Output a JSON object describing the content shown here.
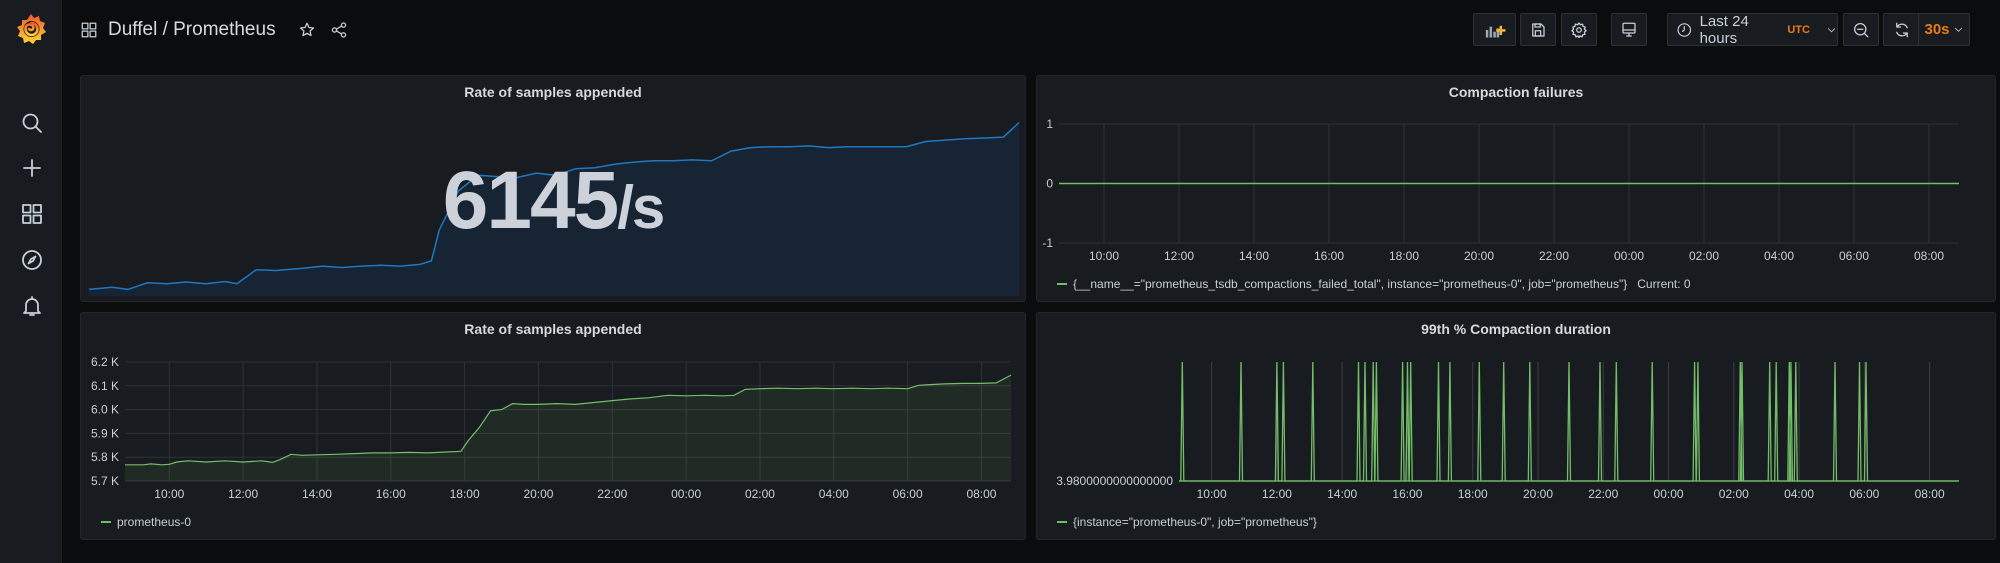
{
  "app": {
    "breadcrumb": "Duffel / Prometheus",
    "brand_color": "#f46800",
    "accent_color": "#eb7b18"
  },
  "sidebar": {
    "items": [
      {
        "id": "search",
        "icon": "search-icon",
        "label": "Search"
      },
      {
        "id": "create",
        "icon": "plus-icon",
        "label": "Create"
      },
      {
        "id": "dashboards",
        "icon": "dashboards-grid-icon",
        "label": "Dashboards"
      },
      {
        "id": "explore",
        "icon": "compass-icon",
        "label": "Explore"
      },
      {
        "id": "alerting",
        "icon": "bell-icon",
        "label": "Alerting"
      }
    ]
  },
  "toolbar": {
    "add_panel_icon": "add-panel-icon",
    "save_icon": "save-icon",
    "settings_icon": "gear-icon",
    "tv_mode_icon": "monitor-icon",
    "time_picker": {
      "label": "Last 24 hours",
      "timezone": "UTC"
    },
    "zoom_out_icon": "zoom-out-icon",
    "refresh_icon": "refresh-icon",
    "refresh_interval": "30s"
  },
  "panels": {
    "stat": {
      "title": "Rate of samples appended",
      "value": "6145",
      "unit": "/s",
      "color": "#1f78c1"
    },
    "failures": {
      "title": "Compaction failures",
      "legend": "{__name__=\"prometheus_tsdb_compactions_failed_total\", instance=\"prometheus-0\", job=\"prometheus\"}",
      "legend_current_label": "Current: 0"
    },
    "rate": {
      "title": "Rate of samples appended",
      "legend": "prometheus-0"
    },
    "duration": {
      "title": "99th % Compaction duration",
      "legend": "{instance=\"prometheus-0\", job=\"prometheus\"}"
    }
  },
  "chart_data": [
    {
      "id": "stat",
      "type": "area",
      "title": "Rate of samples appended",
      "value_label": "6145/s",
      "x_range_hours": [
        9.0,
        32.9
      ],
      "ylim": [
        5750,
        6160
      ],
      "series": [
        {
          "name": "prometheus-0",
          "color": "#1f78c1",
          "points": [
            [
              9.0,
              5765
            ],
            [
              9.6,
              5770
            ],
            [
              10.0,
              5765
            ],
            [
              10.5,
              5780
            ],
            [
              11.0,
              5778
            ],
            [
              11.5,
              5782
            ],
            [
              12.0,
              5778
            ],
            [
              12.5,
              5783
            ],
            [
              12.8,
              5778
            ],
            [
              13.3,
              5810
            ],
            [
              13.8,
              5808
            ],
            [
              14.5,
              5813
            ],
            [
              15.0,
              5818
            ],
            [
              15.5,
              5815
            ],
            [
              16.0,
              5818
            ],
            [
              16.5,
              5820
            ],
            [
              17.0,
              5818
            ],
            [
              17.5,
              5822
            ],
            [
              17.8,
              5830
            ],
            [
              18.0,
              5900
            ],
            [
              18.5,
              5990
            ],
            [
              19.0,
              6025
            ],
            [
              19.5,
              6022
            ],
            [
              20.0,
              6020
            ],
            [
              20.5,
              6030
            ],
            [
              21.0,
              6025
            ],
            [
              21.5,
              6040
            ],
            [
              22.0,
              6042
            ],
            [
              22.5,
              6050
            ],
            [
              23.0,
              6055
            ],
            [
              23.5,
              6058
            ],
            [
              24.0,
              6058
            ],
            [
              24.5,
              6060
            ],
            [
              25.0,
              6058
            ],
            [
              25.5,
              6080
            ],
            [
              26.0,
              6088
            ],
            [
              26.5,
              6090
            ],
            [
              27.0,
              6090
            ],
            [
              27.5,
              6092
            ],
            [
              28.0,
              6088
            ],
            [
              28.5,
              6090
            ],
            [
              29.0,
              6090
            ],
            [
              29.5,
              6090
            ],
            [
              30.0,
              6090
            ],
            [
              30.5,
              6102
            ],
            [
              31.0,
              6105
            ],
            [
              31.5,
              6108
            ],
            [
              32.0,
              6110
            ],
            [
              32.5,
              6112
            ],
            [
              32.9,
              6145
            ]
          ]
        }
      ]
    },
    {
      "id": "failures",
      "type": "line",
      "title": "Compaction failures",
      "x_ticks": [
        "10:00",
        "12:00",
        "14:00",
        "16:00",
        "18:00",
        "20:00",
        "22:00",
        "00:00",
        "02:00",
        "04:00",
        "06:00",
        "08:00"
      ],
      "y_ticks": [
        "1",
        "0",
        "-1"
      ],
      "ylim": [
        -1,
        1
      ],
      "x_range_hours": [
        8.8,
        32.8
      ],
      "grid": true,
      "series": [
        {
          "name": "{__name__=\"prometheus_tsdb_compactions_failed_total\", instance=\"prometheus-0\", job=\"prometheus\"}",
          "color": "#73bf69",
          "values": "constant 0"
        }
      ]
    },
    {
      "id": "rate",
      "type": "area",
      "title": "Rate of samples appended",
      "x_ticks": [
        "10:00",
        "12:00",
        "14:00",
        "16:00",
        "18:00",
        "20:00",
        "22:00",
        "00:00",
        "02:00",
        "04:00",
        "06:00",
        "08:00"
      ],
      "y_ticks": [
        "6.2 K",
        "6.1 K",
        "6.0 K",
        "5.9 K",
        "5.8 K",
        "5.7 K"
      ],
      "ylim": [
        5700,
        6200
      ],
      "x_range_hours": [
        8.8,
        32.8
      ],
      "grid": true,
      "legend": "bottom-left",
      "series": [
        {
          "name": "prometheus-0",
          "color": "#73bf69",
          "points": [
            [
              8.8,
              5768
            ],
            [
              9.3,
              5768
            ],
            [
              9.5,
              5772
            ],
            [
              9.8,
              5768
            ],
            [
              10.0,
              5770
            ],
            [
              10.2,
              5780
            ],
            [
              10.5,
              5785
            ],
            [
              11.0,
              5780
            ],
            [
              11.5,
              5785
            ],
            [
              12.0,
              5780
            ],
            [
              12.5,
              5785
            ],
            [
              12.8,
              5778
            ],
            [
              13.0,
              5790
            ],
            [
              13.3,
              5812
            ],
            [
              13.6,
              5808
            ],
            [
              14.0,
              5810
            ],
            [
              14.5,
              5812
            ],
            [
              15.0,
              5815
            ],
            [
              15.5,
              5818
            ],
            [
              16.0,
              5818
            ],
            [
              16.5,
              5820
            ],
            [
              17.0,
              5818
            ],
            [
              17.5,
              5822
            ],
            [
              17.9,
              5825
            ],
            [
              18.1,
              5870
            ],
            [
              18.4,
              5925
            ],
            [
              18.7,
              5995
            ],
            [
              19.0,
              6000
            ],
            [
              19.3,
              6025
            ],
            [
              19.6,
              6022
            ],
            [
              20.0,
              6022
            ],
            [
              20.5,
              6025
            ],
            [
              21.0,
              6022
            ],
            [
              21.5,
              6030
            ],
            [
              22.0,
              6038
            ],
            [
              22.5,
              6045
            ],
            [
              23.0,
              6050
            ],
            [
              23.5,
              6060
            ],
            [
              24.0,
              6058
            ],
            [
              24.5,
              6060
            ],
            [
              25.0,
              6058
            ],
            [
              25.3,
              6060
            ],
            [
              25.6,
              6085
            ],
            [
              26.0,
              6088
            ],
            [
              26.5,
              6090
            ],
            [
              27.0,
              6088
            ],
            [
              27.5,
              6090
            ],
            [
              28.0,
              6088
            ],
            [
              28.5,
              6090
            ],
            [
              29.0,
              6088
            ],
            [
              29.5,
              6090
            ],
            [
              30.0,
              6088
            ],
            [
              30.3,
              6102
            ],
            [
              30.6,
              6105
            ],
            [
              31.0,
              6108
            ],
            [
              31.5,
              6110
            ],
            [
              32.0,
              6110
            ],
            [
              32.4,
              6112
            ],
            [
              32.8,
              6145
            ]
          ]
        }
      ]
    },
    {
      "id": "duration",
      "type": "line",
      "title": "99th % Compaction duration",
      "x_ticks": [
        "10:00",
        "12:00",
        "14:00",
        "16:00",
        "18:00",
        "20:00",
        "22:00",
        "00:00",
        "02:00",
        "04:00",
        "06:00",
        "08:00"
      ],
      "y_ticks": [
        "3.9800000000000000"
      ],
      "x_range_hours": [
        9.0,
        32.9
      ],
      "grid": true,
      "series": [
        {
          "name": "{instance=\"prometheus-0\", job=\"prometheus\"}",
          "color": "#73bf69",
          "baseline": 3.98,
          "spike_times_hours": [
            9.1,
            10.9,
            12.0,
            12.2,
            13.1,
            14.5,
            14.7,
            14.95,
            15.05,
            15.85,
            16.0,
            16.1,
            16.95,
            17.3,
            18.2,
            18.95,
            19.75,
            20.95,
            21.9,
            22.4,
            23.5,
            24.8,
            24.9,
            26.2,
            26.25,
            27.1,
            27.3,
            27.7,
            27.75,
            27.9,
            29.1,
            29.85,
            30.05
          ]
        }
      ]
    }
  ]
}
